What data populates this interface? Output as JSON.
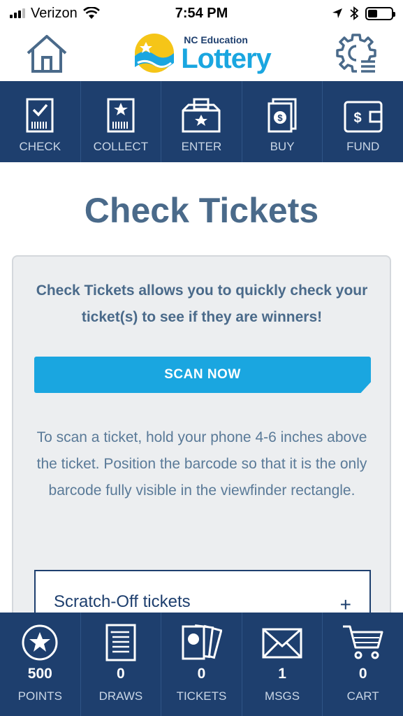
{
  "status_bar": {
    "carrier": "Verizon",
    "time": "7:54 PM"
  },
  "header": {
    "logo_small": "NC Education",
    "logo_big": "Lottery"
  },
  "top_nav": [
    {
      "label": "CHECK",
      "icon": "check-ticket-icon"
    },
    {
      "label": "COLLECT",
      "icon": "collect-ticket-icon"
    },
    {
      "label": "ENTER",
      "icon": "ballot-box-icon"
    },
    {
      "label": "BUY",
      "icon": "buy-coin-icon"
    },
    {
      "label": "FUND",
      "icon": "wallet-icon"
    }
  ],
  "page": {
    "title": "Check Tickets",
    "intro": "Check Tickets allows you to quickly check your ticket(s) to see if they are winners!",
    "scan_button": "SCAN NOW",
    "instructions": "To scan a ticket, hold your phone 4-6 inches above the ticket. Position the barcode so that it is the only barcode fully visible in the viewfinder rectangle.",
    "accordion_label": "Scratch-Off tickets",
    "accordion_toggle": "+"
  },
  "bottom_nav": [
    {
      "count": "500",
      "label": "POINTS",
      "icon": "star-badge-icon"
    },
    {
      "count": "0",
      "label": "DRAWS",
      "icon": "draw-list-icon"
    },
    {
      "count": "0",
      "label": "TICKETS",
      "icon": "tickets-icon"
    },
    {
      "count": "1",
      "label": "MSGS",
      "icon": "envelope-icon"
    },
    {
      "count": "0",
      "label": "CART",
      "icon": "cart-icon"
    }
  ],
  "colors": {
    "navy": "#1e3f6e",
    "accent_blue": "#1aa6e0",
    "title_slate": "#4a6a8a",
    "card_bg": "#eceef0"
  }
}
